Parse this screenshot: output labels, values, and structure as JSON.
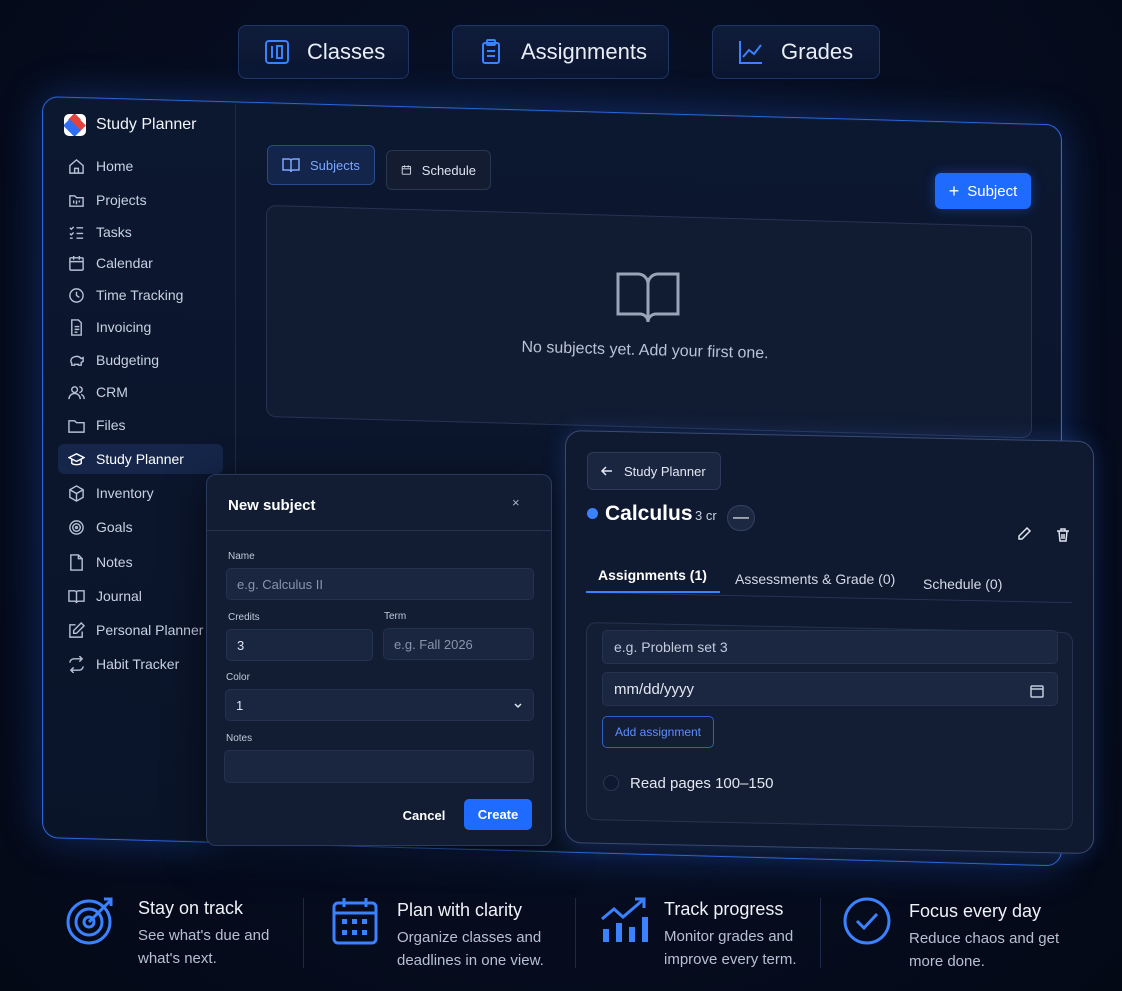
{
  "top_features": [
    {
      "label": "Classes",
      "icon": "book-square-icon"
    },
    {
      "label": "Assignments",
      "icon": "clipboard-icon"
    },
    {
      "label": "Grades",
      "icon": "line-chart-icon"
    }
  ],
  "app": {
    "brand": "Study Planner",
    "nav": [
      {
        "label": "Home",
        "icon": "home-icon"
      },
      {
        "label": "Projects",
        "icon": "folder-kanban-icon"
      },
      {
        "label": "Tasks",
        "icon": "checklist-icon"
      },
      {
        "label": "Calendar",
        "icon": "calendar-icon"
      },
      {
        "label": "Time Tracking",
        "icon": "clock-icon"
      },
      {
        "label": "Invoicing",
        "icon": "invoice-icon"
      },
      {
        "label": "Budgeting",
        "icon": "piggy-bank-icon"
      },
      {
        "label": "CRM",
        "icon": "users-icon"
      },
      {
        "label": "Files",
        "icon": "folder-icon"
      },
      {
        "label": "Study Planner",
        "icon": "graduation-cap-icon",
        "active": true
      },
      {
        "label": "Inventory",
        "icon": "box-icon"
      },
      {
        "label": "Goals",
        "icon": "target-icon"
      },
      {
        "label": "Notes",
        "icon": "note-icon"
      },
      {
        "label": "Journal",
        "icon": "open-book-icon"
      },
      {
        "label": "Personal Planner",
        "icon": "edit-square-icon"
      },
      {
        "label": "Habit Tracker",
        "icon": "repeat-icon"
      }
    ],
    "tabs": {
      "subjects": "Subjects",
      "schedule": "Schedule"
    },
    "add_subject": "Subject",
    "empty_state": "No subjects yet. Add your first one."
  },
  "modal": {
    "title": "New subject",
    "close": "×",
    "name_label": "Name",
    "name_placeholder": "e.g. Calculus II",
    "credits_label": "Credits",
    "credits_value": "3",
    "term_label": "Term",
    "term_placeholder": "e.g. Fall 2026",
    "color_label": "Color",
    "color_value": "1",
    "notes_label": "Notes",
    "cancel": "Cancel",
    "create": "Create"
  },
  "detail": {
    "back": "Study Planner",
    "subject": "Calculus",
    "credits": "3 cr",
    "toggle": "—",
    "tabs": [
      "Assignments (1)",
      "Assessments & Grade (0)",
      "Schedule (0)"
    ],
    "assignment_placeholder": "e.g. Problem set 3",
    "date_placeholder": "mm/dd/yyyy",
    "add_assignment": "Add assignment",
    "tasks": [
      "Read pages 100–150"
    ],
    "accent": "#3b82ff"
  },
  "bottom_features": [
    {
      "title": "Stay on track",
      "desc": "See what's due and what's next.",
      "icon": "target-arrow-icon"
    },
    {
      "title": "Plan with clarity",
      "desc": "Organize classes and deadlines in one view.",
      "icon": "calendar-grid-icon"
    },
    {
      "title": "Track progress",
      "desc": "Monitor grades and improve every term.",
      "icon": "bar-trend-icon"
    },
    {
      "title": "Focus every day",
      "desc": "Reduce chaos and get more done.",
      "icon": "check-circle-icon"
    }
  ]
}
